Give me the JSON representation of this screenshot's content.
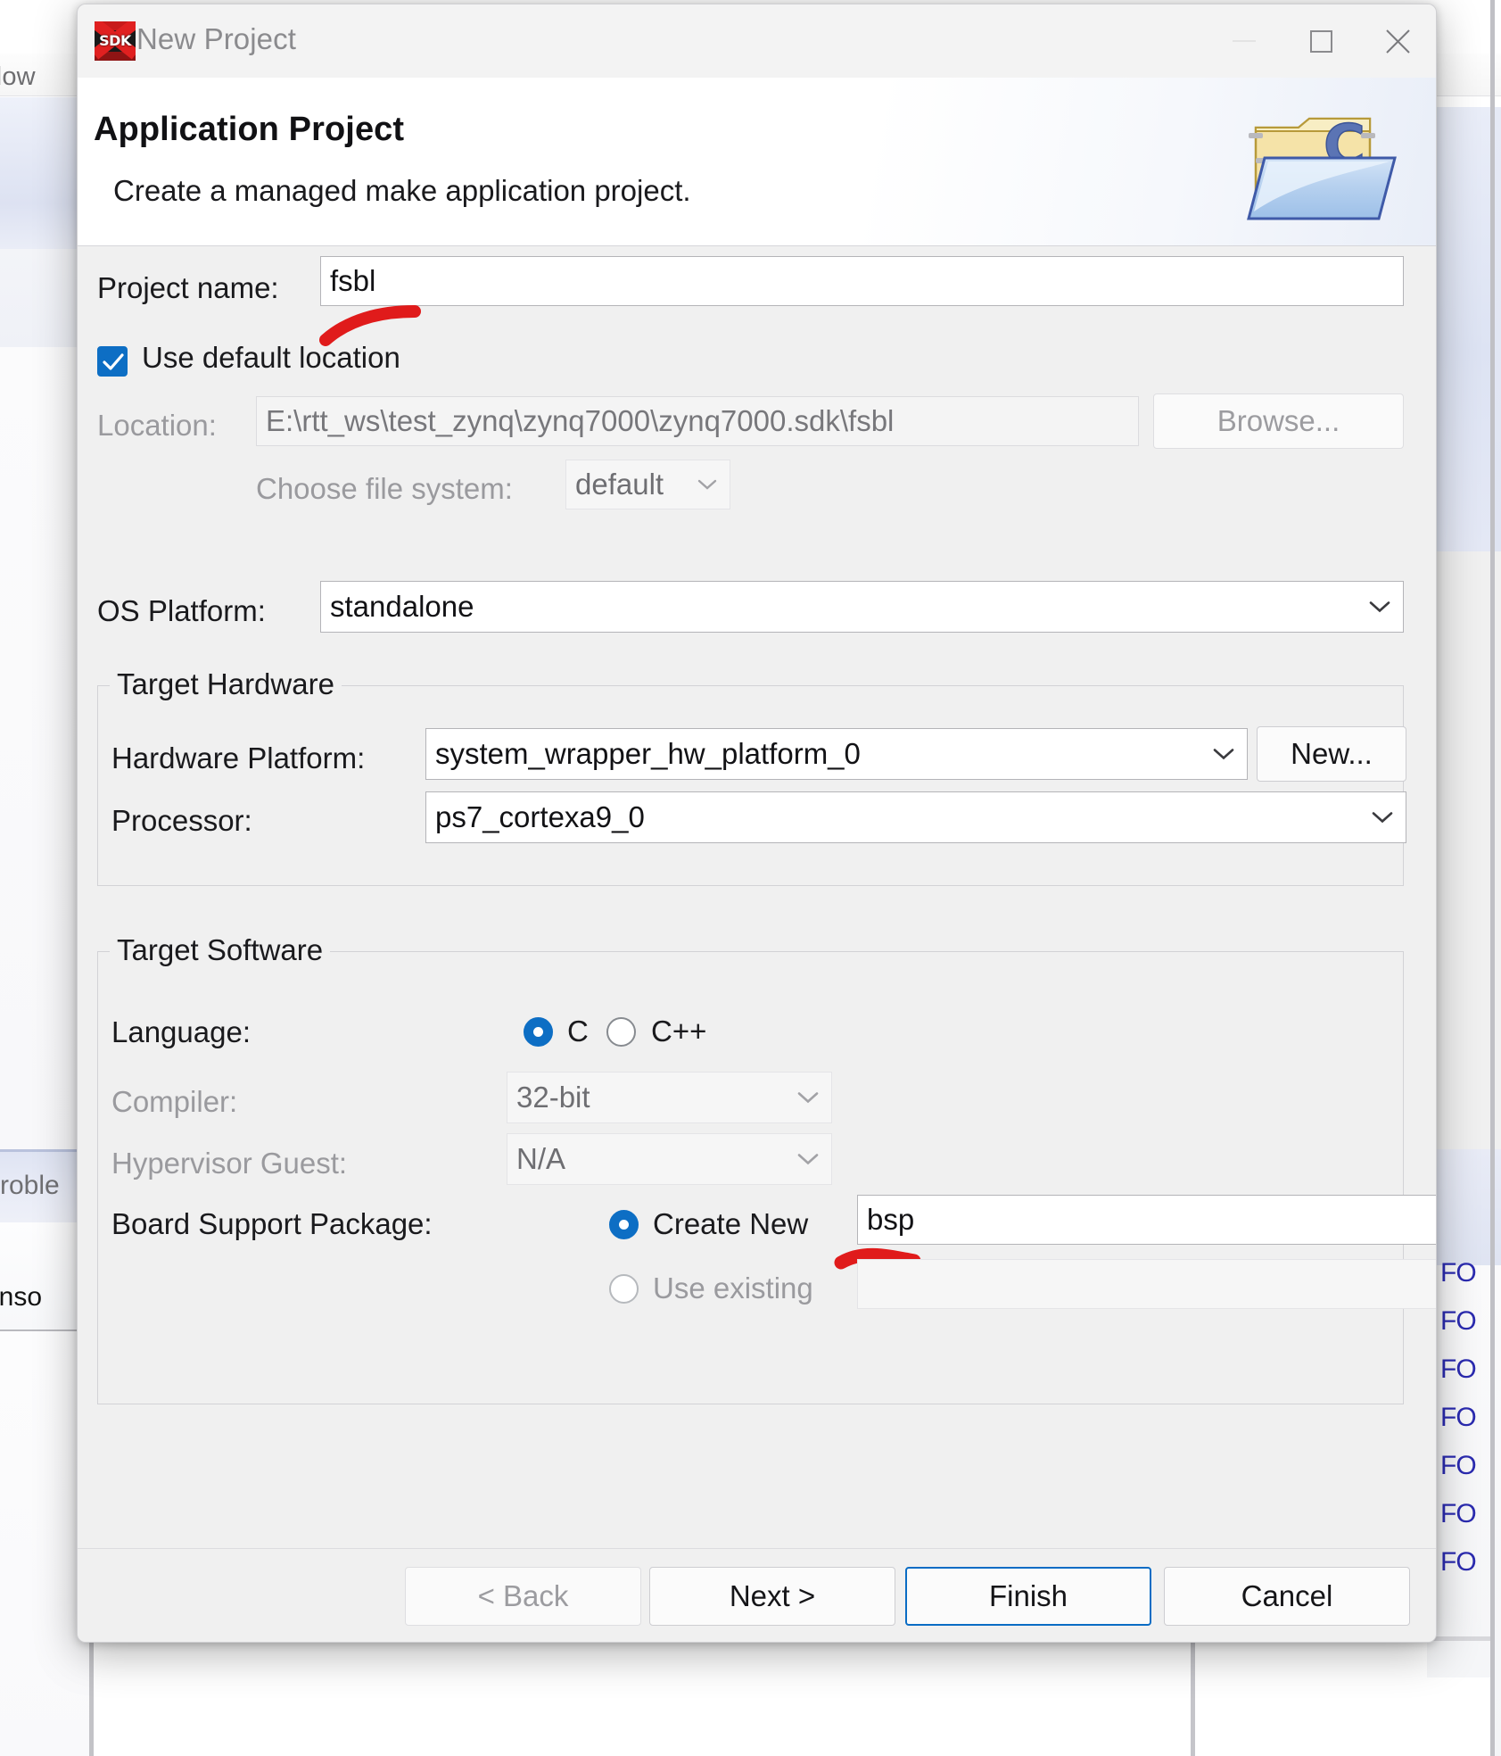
{
  "background": {
    "menu_fragment": "dow",
    "problems_tab": "Proble",
    "console_tab": "onso",
    "console_lines": [
      "FO",
      "FO",
      "FO",
      "FO",
      "FO",
      "FO",
      "FO"
    ]
  },
  "window": {
    "title": "New Project",
    "app_icon": "sdk-icon",
    "minimize_label": "minimize",
    "maximize_label": "maximize",
    "close_label": "close"
  },
  "header": {
    "title": "Application Project",
    "subtitle": "Create a managed make application project.",
    "icon": "c-project-folder-icon"
  },
  "form": {
    "project_name_label": "Project name:",
    "project_name_value": "fsbl",
    "use_default_location_label": "Use default location",
    "use_default_location_checked": true,
    "location_label": "Location:",
    "location_value": "E:\\rtt_ws\\test_zynq\\zynq7000\\zynq7000.sdk\\fsbl",
    "browse_label": "Browse...",
    "choose_file_system_label": "Choose file system:",
    "file_system_value": "default",
    "os_platform_label": "OS Platform:",
    "os_platform_value": "standalone"
  },
  "target_hardware": {
    "group_title": "Target Hardware",
    "hardware_platform_label": "Hardware Platform:",
    "hardware_platform_value": "system_wrapper_hw_platform_0",
    "new_button_label": "New...",
    "processor_label": "Processor:",
    "processor_value": "ps7_cortexa9_0"
  },
  "target_software": {
    "group_title": "Target Software",
    "language_label": "Language:",
    "language_options": [
      "C",
      "C++"
    ],
    "language_selected": "C",
    "compiler_label": "Compiler:",
    "compiler_value": "32-bit",
    "hypervisor_label": "Hypervisor Guest:",
    "hypervisor_value": "N/A",
    "bsp_label": "Board Support Package:",
    "bsp_create_new_label": "Create New",
    "bsp_create_new_value": "bsp",
    "bsp_use_existing_label": "Use existing",
    "bsp_use_existing_value": "",
    "bsp_selected": "Create New"
  },
  "footer": {
    "back_label": "< Back",
    "next_label": "Next >",
    "finish_label": "Finish",
    "cancel_label": "Cancel",
    "back_enabled": false,
    "default_button": "Finish"
  },
  "colors": {
    "accent": "#0d6ec4",
    "annotation": "#e01b1b",
    "dialog_bg": "#f0f0f0",
    "text": "#1a1a1d",
    "disabled_text": "#9a9a9e",
    "console_text": "#2b2bb0"
  }
}
